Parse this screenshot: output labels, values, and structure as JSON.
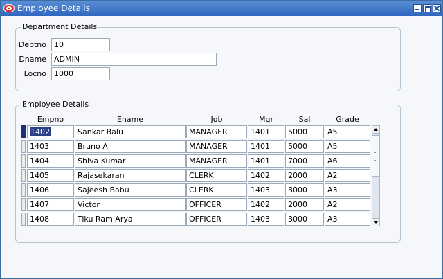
{
  "window": {
    "title": "Employee Details"
  },
  "department": {
    "group_title": "Department Details",
    "deptno_label": "Deptno",
    "deptno_value": "10",
    "dname_label": "Dname",
    "dname_value": "ADMIN",
    "locno_label": "Locno",
    "locno_value": "1000"
  },
  "employees": {
    "group_title": "Employee Details",
    "columns": [
      "Empno",
      "Ename",
      "Job",
      "Mgr",
      "Sal",
      "Grade"
    ],
    "rows": [
      [
        "1402",
        "Sankar Balu",
        "MANAGER",
        "1401",
        "5000",
        "A5"
      ],
      [
        "1403",
        "Bruno A",
        "MANAGER",
        "1401",
        "5000",
        "A5"
      ],
      [
        "1404",
        "Shiva Kumar",
        "MANAGER",
        "1401",
        "7000",
        "A6"
      ],
      [
        "1405",
        "Rajasekaran",
        "CLERK",
        "1402",
        "2000",
        "A2"
      ],
      [
        "1406",
        "Sajeesh Babu",
        "CLERK",
        "1403",
        "3000",
        "A3"
      ],
      [
        "1407",
        "Victor",
        "OFFICER",
        "1402",
        "2000",
        "A2"
      ],
      [
        "1408",
        "Tiku Ram Arya",
        "OFFICER",
        "1403",
        "3000",
        "A3"
      ]
    ],
    "selected_row": 0
  },
  "icons": {
    "app": "oracle-app-icon",
    "minimize": "minimize-icon",
    "maximize": "maximize-icon",
    "close": "close-icon"
  },
  "colors": {
    "titlebar": "#2f67c0",
    "selection": "#2a3f86",
    "active_record": "#1f2d7a"
  }
}
